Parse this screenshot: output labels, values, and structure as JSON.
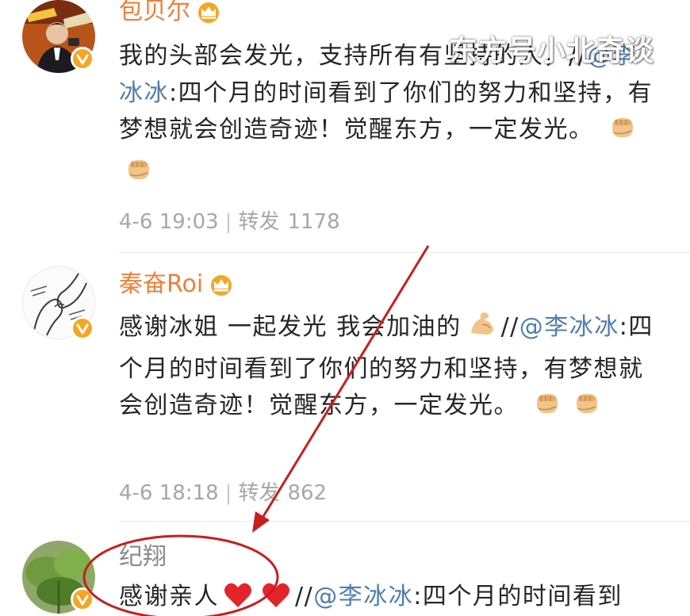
{
  "watermark": "东方号小北奇谈",
  "colors": {
    "username": "#ee7f3a",
    "username_plain": "#8b8b8b",
    "mention": "#507daf",
    "body_text": "#262626",
    "meta_text": "#a7a7a7",
    "verified_badge": "#f6a623",
    "crown": "#f5a623",
    "annotation": "#c81e1e"
  },
  "posts": [
    {
      "username": "包贝尔",
      "has_crown": true,
      "verified": true,
      "avatar": "avatar-photo-icon",
      "text_before": "我的头部会发光，支持所有有坚持的人，//",
      "mention": "@李冰冰",
      "text_after": ":四个月的时间看到了你们的努力和坚持，有梦想就会创造奇迹！觉醒东方，一定发光。",
      "emojis": [
        "fist-emoji-icon",
        "fist-emoji-icon"
      ],
      "time": "4-6 19:03",
      "repost_label": "转发",
      "repost_count": "1178"
    },
    {
      "username": "秦奋Roi",
      "has_crown": true,
      "verified": true,
      "avatar": "avatar-hands-drawing-icon",
      "text_before": "感谢冰姐 一起发光 我会加油的",
      "mention": "@李冰冰",
      "text_after": ":四个月的时间看到了你们的努力和坚持，有梦想就会创造奇迹！觉醒东方，一定发光。",
      "mid_emoji": "flexed-biceps-emoji-icon",
      "emojis": [
        "fist-emoji-icon",
        "fist-emoji-icon"
      ],
      "time": "4-6 18:18",
      "repost_label": "转发",
      "repost_count": "862"
    },
    {
      "username": "纪翔",
      "has_crown": false,
      "verified": true,
      "avatar": "avatar-green-plant-icon",
      "text_before": "感谢亲人",
      "mid_emojis": [
        "red-heart-emoji-icon",
        "red-heart-emoji-icon"
      ],
      "mention": "@李冰冰",
      "text_after": ":四个月的时间看到"
    }
  ],
  "annotation": {
    "shapes": [
      "red-arrow",
      "red-ellipse"
    ],
    "target": "纪翔"
  }
}
